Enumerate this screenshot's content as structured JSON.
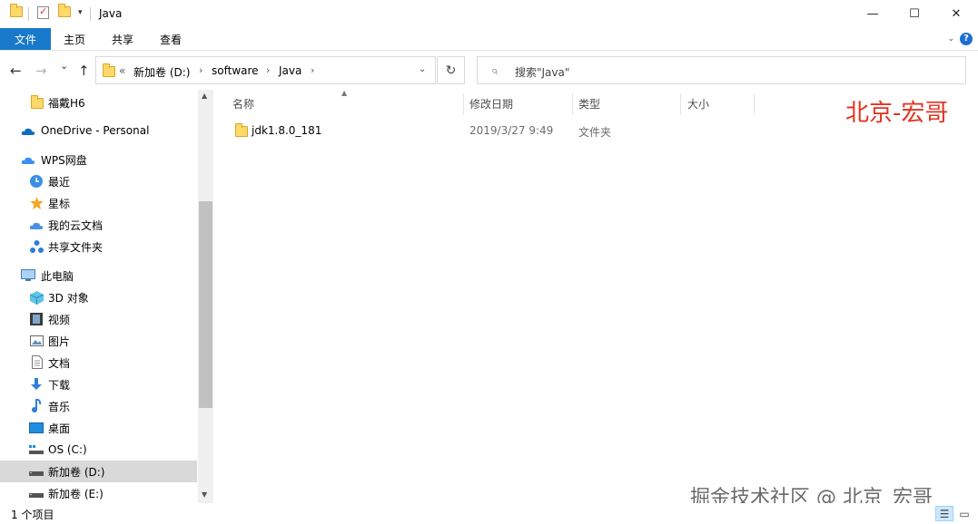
{
  "titlebar": {
    "title": "Java",
    "qa_dropdown": "▾",
    "minimize": "—",
    "maximize": "☐",
    "close": "✕"
  },
  "ribbon": {
    "tabs": [
      "文件",
      "主页",
      "共享",
      "查看"
    ],
    "expand_icon": "chevron-down-icon",
    "help_label": "?"
  },
  "address": {
    "back": "←",
    "forward": "→",
    "recent": "⌄",
    "up": "↑",
    "overflow": "«",
    "breadcrumbs": [
      "新加卷 (D:)",
      "software",
      "Java"
    ],
    "separator": "›",
    "dropdown": "⌄",
    "refresh": "↻"
  },
  "search": {
    "icon": "search-icon",
    "placeholder": "搜索\"Java\""
  },
  "sidebar": {
    "items": [
      {
        "label": "福戴H6",
        "icon": "folder-icon"
      },
      {
        "label": "OneDrive - Personal",
        "icon": "onedrive-icon"
      },
      {
        "label": "WPS网盘",
        "icon": "wps-cloud-icon"
      },
      {
        "label": "最近",
        "icon": "clock-icon"
      },
      {
        "label": "星标",
        "icon": "star-icon"
      },
      {
        "label": "我的云文档",
        "icon": "cloud-icon"
      },
      {
        "label": "共享文件夹",
        "icon": "share-icon"
      },
      {
        "label": "此电脑",
        "icon": "computer-icon"
      },
      {
        "label": "3D 对象",
        "icon": "cube-icon"
      },
      {
        "label": "视频",
        "icon": "video-icon"
      },
      {
        "label": "图片",
        "icon": "picture-icon"
      },
      {
        "label": "文档",
        "icon": "document-icon"
      },
      {
        "label": "下载",
        "icon": "download-icon"
      },
      {
        "label": "音乐",
        "icon": "music-icon"
      },
      {
        "label": "桌面",
        "icon": "desktop-icon"
      },
      {
        "label": "OS (C:)",
        "icon": "drive-c-icon"
      },
      {
        "label": "新加卷 (D:)",
        "icon": "drive-icon"
      },
      {
        "label": "新加卷 (E:)",
        "icon": "drive-icon"
      }
    ],
    "selected": "新加卷 (D:)"
  },
  "filelist": {
    "columns": [
      "名称",
      "修改日期",
      "类型",
      "大小"
    ],
    "rows": [
      {
        "name": "jdk1.8.0_181",
        "date": "2019/3/27 9:49",
        "type": "文件夹",
        "size": ""
      }
    ]
  },
  "watermarks": {
    "red": "北京-宏哥",
    "gray": "掘金技术社区 @ 北京_宏哥"
  },
  "status": {
    "text": "1 个项目"
  },
  "colors": {
    "accent": "#1979ca",
    "selected_bg": "#d9d9d9",
    "folder": "#ffd86b",
    "watermark_red": "#e0331f"
  }
}
